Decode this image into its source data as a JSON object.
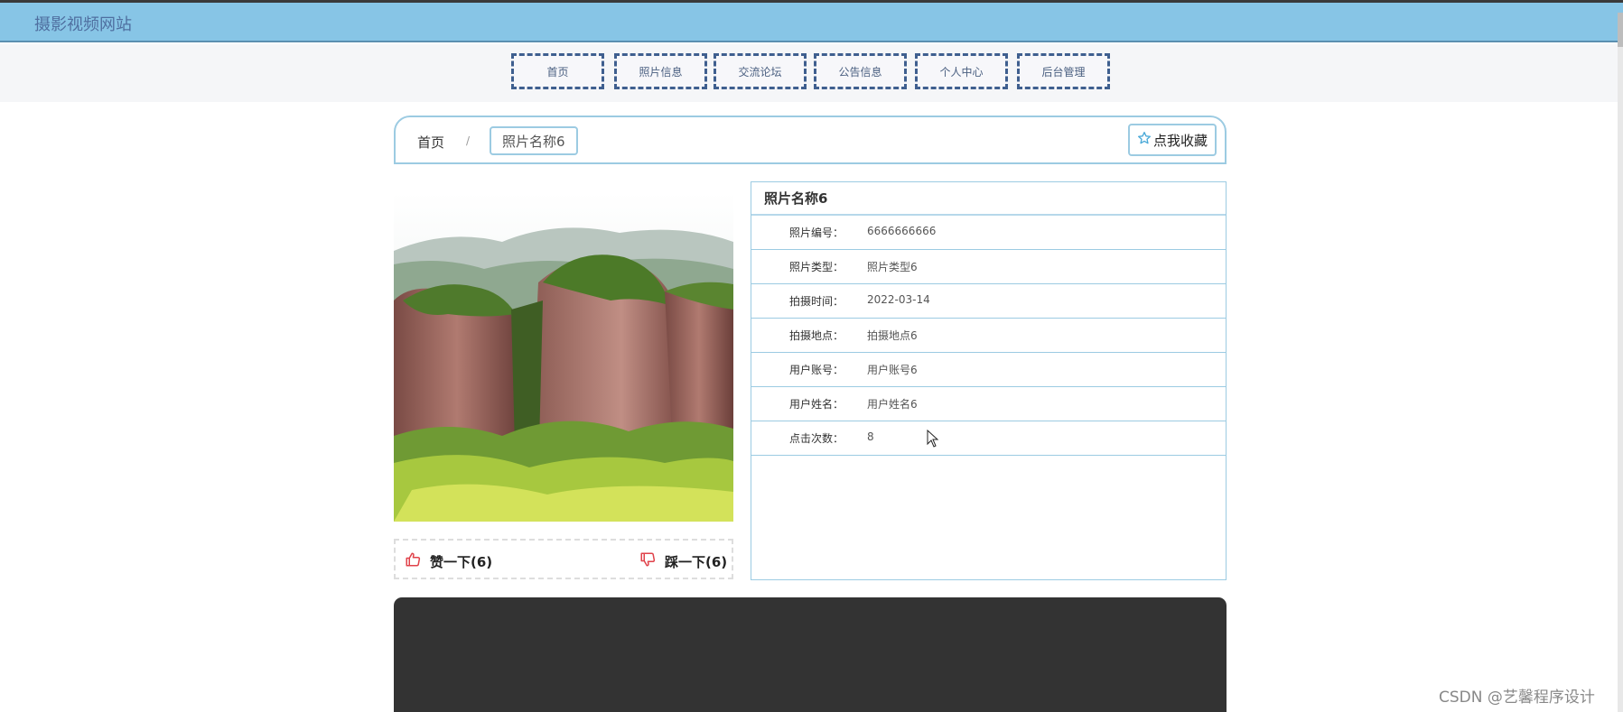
{
  "header": {
    "site_title": "摄影视频网站"
  },
  "nav": {
    "items": [
      {
        "label": "首页"
      },
      {
        "label": "照片信息"
      },
      {
        "label": "交流论坛"
      },
      {
        "label": "公告信息"
      },
      {
        "label": "个人中心"
      },
      {
        "label": "后台管理"
      }
    ]
  },
  "breadcrumb": {
    "home": "首页",
    "separator": "/",
    "current": "照片名称6"
  },
  "favorite": {
    "label": "点我收藏",
    "icon": "star-outline-icon"
  },
  "votes": {
    "like_label": "赞一下(6)",
    "dislike_label": "踩一下(6)"
  },
  "details": {
    "title": "照片名称6",
    "rows": [
      {
        "label": "照片编号：",
        "value": "6666666666"
      },
      {
        "label": "照片类型：",
        "value": "照片类型6"
      },
      {
        "label": "拍摄时间：",
        "value": "2022-03-14"
      },
      {
        "label": "拍摄地点：",
        "value": "拍摄地点6"
      },
      {
        "label": "用户账号：",
        "value": "用户账号6"
      },
      {
        "label": "用户姓名：",
        "value": "用户姓名6"
      },
      {
        "label": "点击次数：",
        "value": "8"
      }
    ]
  },
  "watermark": "CSDN @艺馨程序设计",
  "colors": {
    "header_bg": "#87c5e6",
    "nav_border": "#3f5f8f",
    "panel_border": "#9ccbe2",
    "icon_red": "#e0424a",
    "dark_panel": "#333333"
  }
}
